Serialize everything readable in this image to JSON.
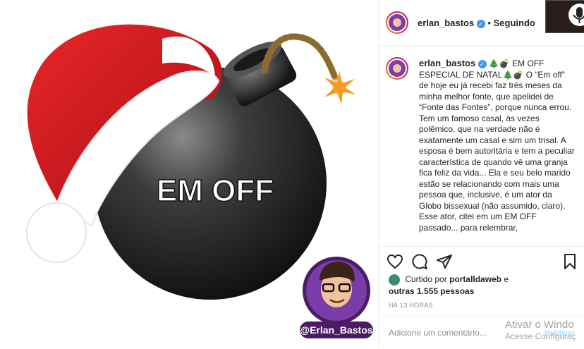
{
  "header": {
    "username": "erlan_bastos",
    "separator": "•",
    "follow_status": "Seguindo"
  },
  "post_image": {
    "bomb_text": "EM OFF",
    "handle": "@Erlan_Bastos"
  },
  "caption": {
    "username": "erlan_bastos",
    "emoji": "🎄💣",
    "text": "EM OFF ESPECIAL DE NATAL🎄💣 O “Em off” de hoje eu já recebi faz três meses da minha melhor fonte, que apelidei de “Fonte das Fontes”, porque nunca errou. Tem um famoso casal, às vezes polêmico, que na verdade não é exatamente um casal e sim um trisal. A esposa é bem autoritária e tem a peculiar característica de quando vê uma granja fica feliz da vida... Ela e seu belo marido estão se relacionando com mais uma pessoa que, inclusive, é um ator da Globo bissexual (não assumido, claro). Esse ator, citei em um EM OFF passado... para relembrar,"
  },
  "likes": {
    "prefix": "Curtido por",
    "user": "portalldaweb",
    "and": "e",
    "others": "outras 1.555 pessoas"
  },
  "time": "HÁ 13 HORAS",
  "comment": {
    "placeholder": "Adicione um comentário...",
    "publish": "Publicar"
  },
  "watermark": {
    "line1": "Ativar o Windo",
    "line2": "Acesse Configuraç"
  },
  "icons": {
    "like": "heart-icon",
    "comment": "comment-icon",
    "share": "send-icon",
    "save": "bookmark-icon",
    "mic": "microphone-icon"
  }
}
